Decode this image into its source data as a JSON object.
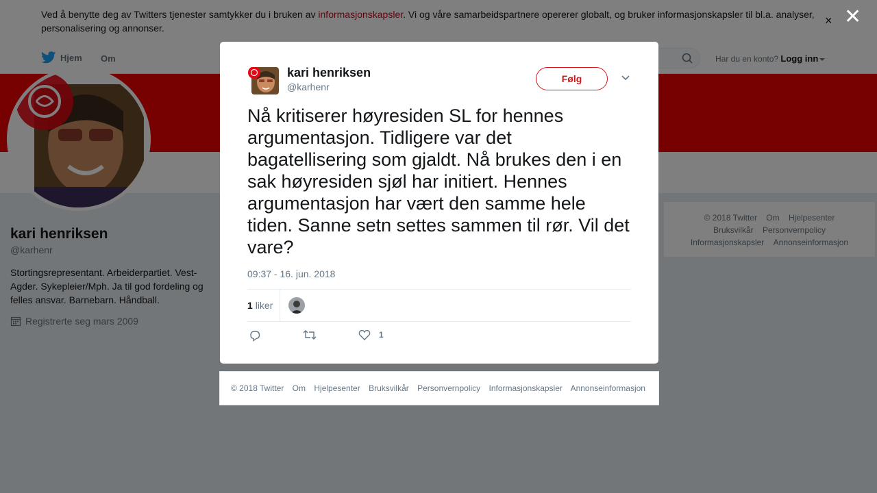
{
  "cookie_banner": {
    "text_before": "Ved å benytte deg av Twitters tjenester samtykker du i bruken av ",
    "link": "informasjonskapsler",
    "text_after": ". Vi og våre samarbeidspartnere opererer globalt, og bruker informasjonskapsler til bl.a. analyser, personalisering og annonser.",
    "close": "×"
  },
  "nav": {
    "home": "Hjem",
    "about": "Om",
    "have_account": "Har du en konto?",
    "login": "Logg inn"
  },
  "profile": {
    "name": "kari henriksen",
    "handle": "@karhenr",
    "bio": "Stortingsrepresentant. Arbeiderpartiet. Vest-Agder. Sykepleier/Mph. Ja til god fordeling og felles ansvar. Barnebarn. Håndball.",
    "joined": "Registrerte seg mars 2009"
  },
  "side_footer": {
    "links": [
      "© 2018 Twitter",
      "Om",
      "Hjelpesenter",
      "Bruksvilkår",
      "Personvernpolicy",
      "Informasjonskapsler",
      "Annonseinformasjon"
    ]
  },
  "overlay": {
    "close": "✕"
  },
  "tweet": {
    "author_name": "kari henriksen",
    "author_handle": "@karhenr",
    "follow_label": "Følg",
    "text": "Nå kritiserer høyresiden SL for hennes argumentasjon. Tidligere var det bagatellisering som gjaldt. Nå brukes den i en sak høyresiden sjøl har initiert. Hennes argumentasjon har vært den samme hele tiden. Sanne setn settes sammen til rør. Vil det vare?",
    "timestamp": "09:37 - 16. jun. 2018",
    "likes_count": "1",
    "likes_label": "liker",
    "like_action_count": "1"
  },
  "modal_footer": {
    "links": [
      "© 2018 Twitter",
      "Om",
      "Hjelpesenter",
      "Bruksvilkår",
      "Personvernpolicy",
      "Informasjonskapsler",
      "Annonseinformasjon"
    ]
  },
  "colors": {
    "banner": "#ee0000",
    "twitter_blue": "#1da1f2",
    "follow_red": "#d7141a",
    "cookie_link": "#d0021b"
  },
  "icons": [
    "twitter-bird-icon",
    "search-icon",
    "calendar-icon",
    "chevron-down-icon",
    "reply-icon",
    "retweet-icon",
    "heart-icon",
    "close-icon"
  ]
}
